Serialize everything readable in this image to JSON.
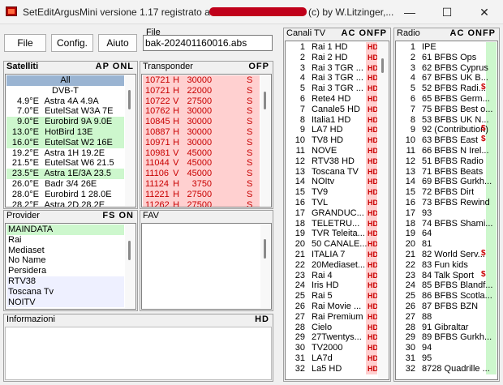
{
  "window": {
    "title": "SetEditArgusMini versione  1.17  registrato a",
    "title_suffix": "(c) by W.Litzinger,...",
    "minimize": "—",
    "maximize": "☐",
    "close": "✕"
  },
  "toolbar": {
    "file_label": "File",
    "config_label": "Config.",
    "help_label": "Aiuto",
    "file_caption": "File",
    "file_name": "bak-202401160016.abs"
  },
  "satellites": {
    "title": "Satelliti",
    "flags": "AP ONL",
    "items": [
      {
        "pos": "",
        "name": "All",
        "style": "sel"
      },
      {
        "pos": "",
        "name": "DVB-T",
        "style": "center"
      },
      {
        "pos": "4.9°E",
        "name": "Astra 4A 4.9A",
        "style": ""
      },
      {
        "pos": "7.0°E",
        "name": "EutelSat W3A 7E",
        "style": ""
      },
      {
        "pos": "9.0°E",
        "name": "Eurobird 9A 9.0E",
        "style": "green"
      },
      {
        "pos": "13.0°E",
        "name": "HotBird 13E",
        "style": "green"
      },
      {
        "pos": "16.0°E",
        "name": "EutelSat W2 16E",
        "style": "green"
      },
      {
        "pos": "19.2°E",
        "name": "Astra 1H 19.2E",
        "style": ""
      },
      {
        "pos": "21.5°E",
        "name": "EutelSat W6 21.5",
        "style": ""
      },
      {
        "pos": "23.5°E",
        "name": "Astra 1E/3A 23.5",
        "style": "green"
      },
      {
        "pos": "26.0°E",
        "name": "Badr 3/4 26E",
        "style": ""
      },
      {
        "pos": "28.0°E",
        "name": "Eurobird 1 28.0E",
        "style": ""
      },
      {
        "pos": "28.2°E",
        "name": "Astra 2D 28.2E",
        "style": ""
      }
    ]
  },
  "transponders": {
    "title": "Transponder",
    "flags": "OFP",
    "items": [
      {
        "freq": "10721",
        "pol": "H",
        "sr": "30000",
        "s": "S"
      },
      {
        "freq": "10721",
        "pol": "H",
        "sr": "22000",
        "s": "S"
      },
      {
        "freq": "10722",
        "pol": "V",
        "sr": "27500",
        "s": "S"
      },
      {
        "freq": "10762",
        "pol": "H",
        "sr": "30000",
        "s": "S"
      },
      {
        "freq": "10845",
        "pol": "H",
        "sr": "30000",
        "s": "S"
      },
      {
        "freq": "10887",
        "pol": "H",
        "sr": "30000",
        "s": "S"
      },
      {
        "freq": "10971",
        "pol": "H",
        "sr": "30000",
        "s": "S"
      },
      {
        "freq": "10981",
        "pol": "V",
        "sr": "45000",
        "s": "S"
      },
      {
        "freq": "11044",
        "pol": "V",
        "sr": "45000",
        "s": "S"
      },
      {
        "freq": "11106",
        "pol": "V",
        "sr": "45000",
        "s": "S"
      },
      {
        "freq": "11124",
        "pol": "H",
        "sr": "3750",
        "s": "S"
      },
      {
        "freq": "11221",
        "pol": "H",
        "sr": "27500",
        "s": "S"
      },
      {
        "freq": "11262",
        "pol": "H",
        "sr": "27500",
        "s": "S"
      }
    ]
  },
  "providers": {
    "title": "Provider",
    "flags": "FS ON",
    "items": [
      {
        "name": "MAINDATA",
        "style": "green"
      },
      {
        "name": "Rai",
        "style": ""
      },
      {
        "name": "Mediaset",
        "style": ""
      },
      {
        "name": "No Name",
        "style": ""
      },
      {
        "name": "Persidera",
        "style": ""
      },
      {
        "name": "RTV38",
        "style": "blue"
      },
      {
        "name": "Toscana Tv",
        "style": "blue"
      },
      {
        "name": "NOITV",
        "style": "blue"
      }
    ]
  },
  "fav": {
    "title": "FAV"
  },
  "info": {
    "title": "Informazioni",
    "flag": "HD"
  },
  "tv": {
    "title": "Canali TV",
    "flags": "AC ONFP",
    "items": [
      {
        "num": "1",
        "name": "Rai 1 HD",
        "hd": "HD"
      },
      {
        "num": "2",
        "name": "Rai 2 HD",
        "hd": "HD"
      },
      {
        "num": "3",
        "name": "Rai 3 TGR ...",
        "hd": "HD"
      },
      {
        "num": "4",
        "name": "Rai 3 TGR ...",
        "hd": "HD"
      },
      {
        "num": "5",
        "name": "Rai 3 TGR ...",
        "hd": "HD"
      },
      {
        "num": "6",
        "name": "Rete4 HD",
        "hd": "HD"
      },
      {
        "num": "7",
        "name": "Canale5 HD",
        "hd": "HD"
      },
      {
        "num": "8",
        "name": "Italia1 HD",
        "hd": "HD"
      },
      {
        "num": "9",
        "name": "LA7 HD",
        "hd": "HD"
      },
      {
        "num": "10",
        "name": "TV8 HD",
        "hd": "HD"
      },
      {
        "num": "11",
        "name": "NOVE",
        "hd": "HD"
      },
      {
        "num": "12",
        "name": "RTV38 HD",
        "hd": "HD"
      },
      {
        "num": "13",
        "name": "Toscana TV",
        "hd": "HD"
      },
      {
        "num": "14",
        "name": "NOItv",
        "hd": "HD"
      },
      {
        "num": "15",
        "name": "TV9",
        "hd": "HD"
      },
      {
        "num": "16",
        "name": "TVL",
        "hd": "HD"
      },
      {
        "num": "17",
        "name": "GRANDUC...",
        "hd": "HD"
      },
      {
        "num": "18",
        "name": "TELETRU...",
        "hd": "HD"
      },
      {
        "num": "19",
        "name": "TVR Teleita...",
        "hd": "HD"
      },
      {
        "num": "20",
        "name": "50 CANALE...",
        "hd": "HD"
      },
      {
        "num": "21",
        "name": "ITALIA 7",
        "hd": "HD"
      },
      {
        "num": "22",
        "name": "20Mediaset...",
        "hd": "HD"
      },
      {
        "num": "23",
        "name": "Rai 4",
        "hd": "HD"
      },
      {
        "num": "24",
        "name": "Iris HD",
        "hd": "HD"
      },
      {
        "num": "25",
        "name": "Rai 5",
        "hd": "HD"
      },
      {
        "num": "26",
        "name": "Rai Movie ...",
        "hd": "HD"
      },
      {
        "num": "27",
        "name": "Rai Premium",
        "hd": "HD"
      },
      {
        "num": "28",
        "name": "Cielo",
        "hd": "HD"
      },
      {
        "num": "29",
        "name": "27Twentys...",
        "hd": "HD"
      },
      {
        "num": "30",
        "name": "TV2000",
        "hd": "HD"
      },
      {
        "num": "31",
        "name": "LA7d",
        "hd": "HD"
      },
      {
        "num": "32",
        "name": "La5 HD",
        "hd": "HD"
      }
    ]
  },
  "radio": {
    "title": "Radio",
    "flags": "AC ONFP",
    "items": [
      {
        "num": "1",
        "name": "IPE",
        "mark": ""
      },
      {
        "num": "2",
        "name": "61 BFBS Ops",
        "mark": ""
      },
      {
        "num": "3",
        "name": "62 BFBS Cyprus",
        "mark": ""
      },
      {
        "num": "4",
        "name": "67 BFBS UK B...",
        "mark": ""
      },
      {
        "num": "5",
        "name": "52 BFBS Radi...",
        "mark": "$"
      },
      {
        "num": "6",
        "name": "65 BFBS Germ...",
        "mark": ""
      },
      {
        "num": "7",
        "name": "75 BFBS Best o...",
        "mark": ""
      },
      {
        "num": "8",
        "name": "53 BFBS UK N...",
        "mark": ""
      },
      {
        "num": "9",
        "name": "92 (Contribution)",
        "mark": "$"
      },
      {
        "num": "10",
        "name": "63 BFBS East",
        "mark": "$"
      },
      {
        "num": "11",
        "name": "66 BFBS N Irel...",
        "mark": ""
      },
      {
        "num": "12",
        "name": "51 BFBS Radio",
        "mark": ""
      },
      {
        "num": "13",
        "name": "71 BFBS Beats",
        "mark": ""
      },
      {
        "num": "14",
        "name": "69 BFBS Gurkh...",
        "mark": ""
      },
      {
        "num": "15",
        "name": "72 BFBS Dirt",
        "mark": ""
      },
      {
        "num": "16",
        "name": "73 BFBS Rewind",
        "mark": ""
      },
      {
        "num": "17",
        "name": "93",
        "mark": ""
      },
      {
        "num": "18",
        "name": "74 BFBS Shami...",
        "mark": ""
      },
      {
        "num": "19",
        "name": "64",
        "mark": ""
      },
      {
        "num": "20",
        "name": "81",
        "mark": ""
      },
      {
        "num": "21",
        "name": "82 World Serv...",
        "mark": "$"
      },
      {
        "num": "22",
        "name": "83 Fun kids",
        "mark": ""
      },
      {
        "num": "23",
        "name": "84 Talk Sport",
        "mark": "$"
      },
      {
        "num": "24",
        "name": "85 BFBS Blandf...",
        "mark": ""
      },
      {
        "num": "25",
        "name": "86 BFBS Scotla...",
        "mark": ""
      },
      {
        "num": "26",
        "name": "87 BFBS BZN",
        "mark": ""
      },
      {
        "num": "27",
        "name": "88",
        "mark": ""
      },
      {
        "num": "28",
        "name": "91 Gibraltar",
        "mark": ""
      },
      {
        "num": "29",
        "name": "89 BFBS Gurkh...",
        "mark": ""
      },
      {
        "num": "30",
        "name": "94",
        "mark": ""
      },
      {
        "num": "31",
        "name": "95",
        "mark": ""
      },
      {
        "num": "32",
        "name": "8728 Quadrille ...",
        "mark": ""
      }
    ]
  }
}
